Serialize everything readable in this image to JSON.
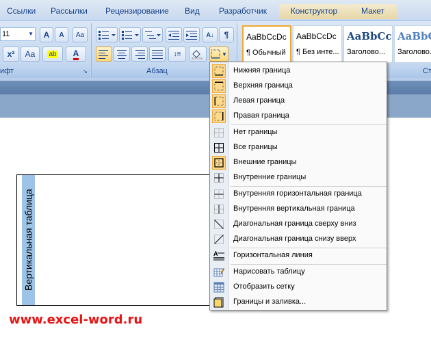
{
  "tabs": [
    "Ссылки",
    "Рассылки",
    "Рецензирование",
    "Вид",
    "Разработчик",
    "Конструктор",
    "Макет"
  ],
  "ribbon": {
    "font_size": "11",
    "group_font_label": "ифт",
    "group_paragraph_label": "Абзац",
    "group_styles_label_partial": "Ст",
    "font_buttons": {
      "grow": "A",
      "shrink": "A",
      "clear": "Aa",
      "superscript": "x²",
      "case": "Aa",
      "highlight": "ab",
      "font_color": "A"
    },
    "pilcrow": "¶"
  },
  "styles": [
    {
      "sample": "AaBbCcDc",
      "name": "¶ Обычный"
    },
    {
      "sample": "AaBbCcDc",
      "name": "¶ Без инте..."
    },
    {
      "sample": "AaBbCc",
      "name": "Заголово..."
    },
    {
      "sample": "AaBbCc",
      "name": "Заголово..."
    }
  ],
  "menu": {
    "items": [
      {
        "label": "Нижняя граница",
        "icon": "border-bottom-icon"
      },
      {
        "label": "Верхняя граница",
        "icon": "border-top-icon"
      },
      {
        "label": "Левая граница",
        "icon": "border-left-icon"
      },
      {
        "label": "Правая граница",
        "icon": "border-right-icon"
      },
      {
        "label": "Нет границы",
        "icon": "border-none-icon"
      },
      {
        "label": "Все границы",
        "icon": "border-all-icon"
      },
      {
        "label": "Внешние границы",
        "icon": "border-outside-icon"
      },
      {
        "label": "Внутренние границы",
        "icon": "border-inside-icon"
      },
      {
        "label": "Внутренняя горизонтальная граница",
        "icon": "border-inside-horizontal-icon"
      },
      {
        "label": "Внутренняя вертикальная граница",
        "icon": "border-inside-vertical-icon"
      },
      {
        "label": "Диагональная граница сверху вниз",
        "icon": "border-diagonal-down-icon"
      },
      {
        "label": "Диагональная граница снизу вверх",
        "icon": "border-diagonal-up-icon"
      },
      {
        "label": "Горизонтальная линия",
        "icon": "horizontal-line-icon"
      },
      {
        "label": "Нарисовать таблицу",
        "icon": "draw-table-icon"
      },
      {
        "label": "Отобразить сетку",
        "icon": "view-gridlines-icon"
      },
      {
        "label": "Границы и заливка...",
        "icon": "borders-and-shading-icon"
      }
    ]
  },
  "document": {
    "vertical_cell_text": "Вертикальная таблица",
    "watermark": "www.excel-word.ru"
  },
  "colors": {
    "ribbon_bg": "#c5d8f0",
    "accent_orange": "#f0a830",
    "cell_fill": "#9dc3e6",
    "watermark_red": "#e81414"
  }
}
